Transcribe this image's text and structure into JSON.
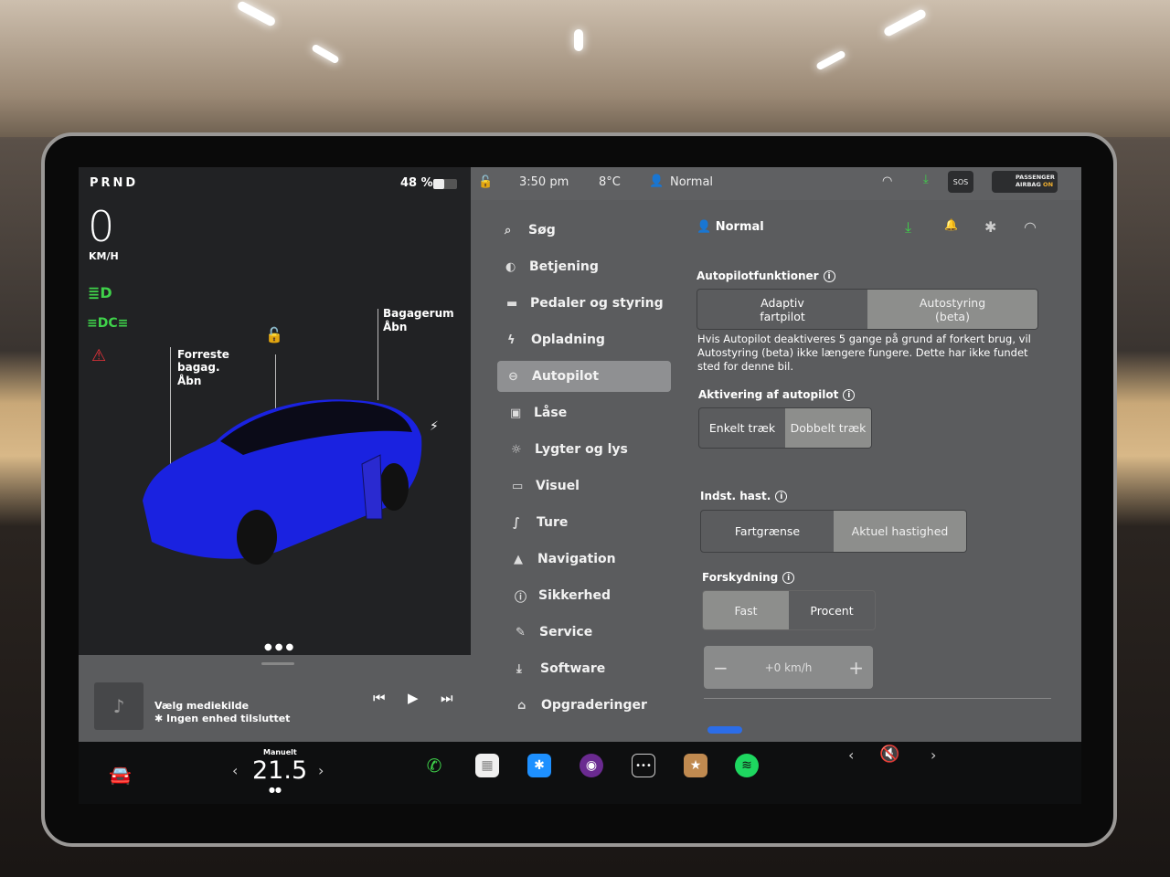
{
  "status": {
    "gear": "PRND",
    "speed": "0",
    "speed_unit": "KM/H",
    "battery": "48 %",
    "battery_level": 0.48
  },
  "car": {
    "frunk_label": "Forreste\nbagag.",
    "frunk_action": "Åbn",
    "trunk_label": "Bagagerum",
    "trunk_action": "Åbn",
    "color": "#1a22e0"
  },
  "media": {
    "title": "Vælg mediekilde",
    "subtitle": "Ingen enhed tilsluttet"
  },
  "topbar": {
    "time": "3:50 pm",
    "temp": "8°C",
    "profile": "Normal",
    "sos": "SOS",
    "airbag_line1": "PASSENGER",
    "airbag_line2": "AIRBAG",
    "airbag_state": "ON"
  },
  "menu": [
    {
      "label": "Søg",
      "icon": "search-icon"
    },
    {
      "label": "Betjening",
      "icon": "toggle-icon"
    },
    {
      "label": "Pedaler og styring",
      "icon": "car-icon"
    },
    {
      "label": "Opladning",
      "icon": "bolt-icon"
    },
    {
      "label": "Autopilot",
      "icon": "steering-wheel-icon",
      "active": true
    },
    {
      "label": "Låse",
      "icon": "lock-icon"
    },
    {
      "label": "Lygter og lys",
      "icon": "sun-icon"
    },
    {
      "label": "Visuel",
      "icon": "display-icon"
    },
    {
      "label": "Ture",
      "icon": "trips-icon"
    },
    {
      "label": "Navigation",
      "icon": "navigation-icon"
    },
    {
      "label": "Sikkerhed",
      "icon": "safety-icon"
    },
    {
      "label": "Service",
      "icon": "wrench-icon"
    },
    {
      "label": "Software",
      "icon": "download-icon"
    },
    {
      "label": "Opgraderinger",
      "icon": "bag-icon"
    }
  ],
  "panel": {
    "profile": "Normal",
    "features_title": "Autopilotfunktioner",
    "features": [
      "Adaptiv\nfartpilot",
      "Autostyring\n(beta)"
    ],
    "features_selected": 1,
    "warning": "Hvis Autopilot deaktiveres 5 gange på grund af forkert brug, vil Autostyring (beta) ikke længere fungere. Dette har ikke fundet sted for denne bil.",
    "activation_title": "Aktivering af autopilot",
    "activation": [
      "Enkelt træk",
      "Dobbelt træk"
    ],
    "speed_title": "Indst. hast.",
    "speed": [
      "Fartgrænse",
      "Aktuel hastighed"
    ],
    "offset_title": "Forskydning",
    "offset": [
      "Fast",
      "Procent"
    ],
    "offset_value": "+0 km/h",
    "minus": "−",
    "plus": "+"
  },
  "dock": {
    "climate_mode": "Manuelt",
    "temperature": "21.5",
    "left_arrow": "‹",
    "right_arrow": "›",
    "volume_icon": "mute-icon"
  }
}
